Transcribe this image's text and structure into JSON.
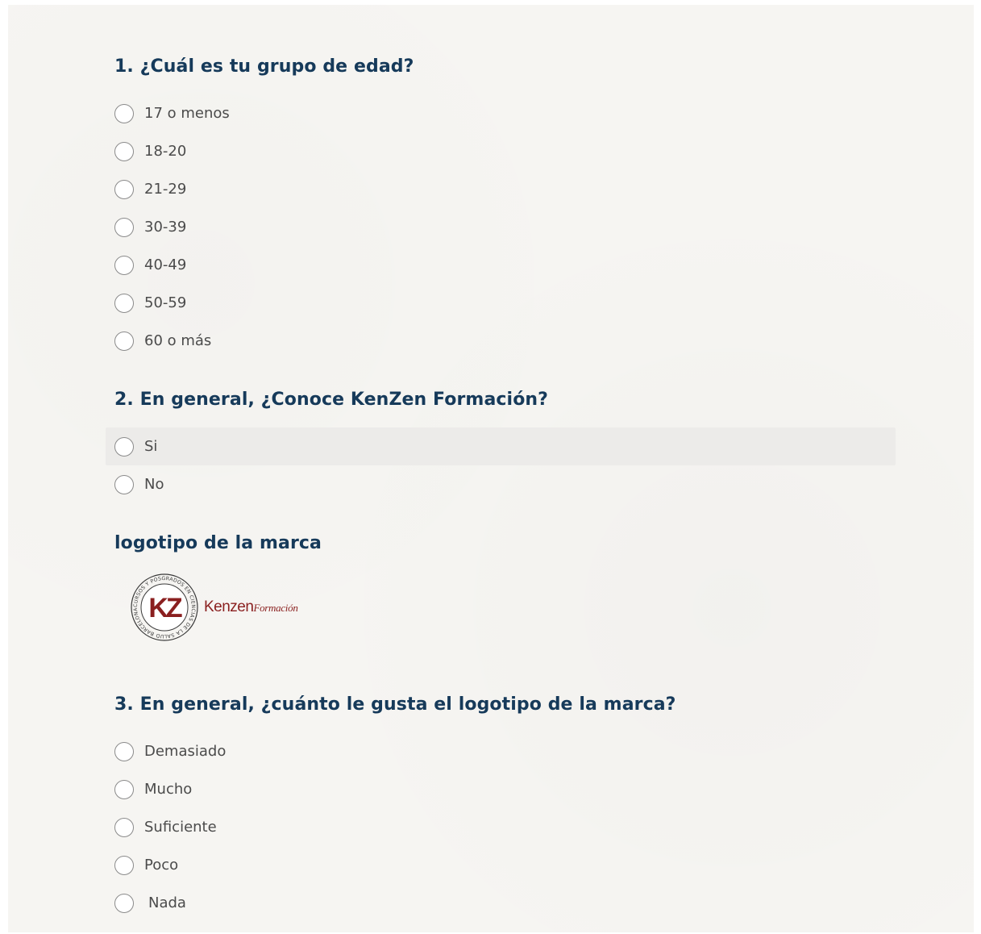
{
  "q1": {
    "title": "1. ¿Cuál es tu grupo de edad?",
    "options": [
      "17 o menos",
      "18-20",
      "21-29",
      "30-39",
      "40-49",
      "50-59",
      "60 o más"
    ]
  },
  "q2": {
    "title": "2. En general, ¿Conoce KenZen Formación?",
    "options": [
      "Si",
      "No"
    ]
  },
  "logo_section": {
    "title": "logotipo de la marca",
    "logo": {
      "monogram": "KZ",
      "brand": "Kenzen",
      "sub": "Formación",
      "ring_text": "CURSOS Y POSGRADOS EN CIENCIAS DE LA SALUD BARCELONA",
      "color": "#8a1f1f"
    }
  },
  "q3": {
    "title": "3. En general, ¿cuánto le gusta el logotipo de la marca?",
    "options": [
      "Demasiado",
      "Mucho",
      "Suficiente",
      "Poco",
      "Nada"
    ]
  },
  "colors": {
    "title": "#163a5a",
    "label": "#4b4b4b",
    "background": "#f6f5f2",
    "highlight": "#ecebe9",
    "brand": "#8a1f1f"
  }
}
